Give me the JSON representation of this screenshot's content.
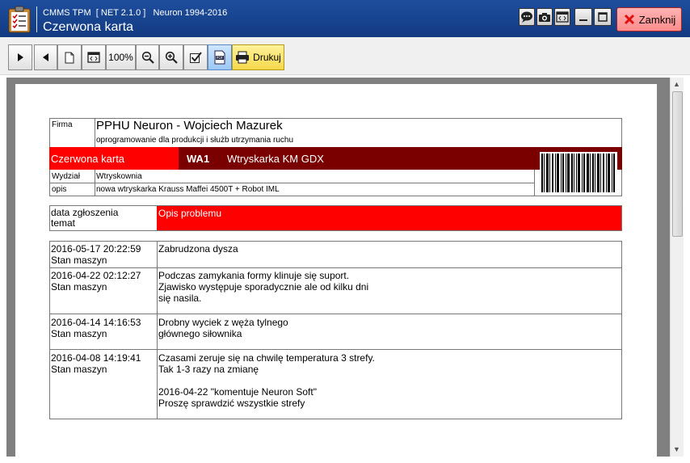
{
  "titlebar": {
    "app_line": "CMMS TPM  [ NET 2.1.0 ]   Neuron 1994-2016",
    "window_title": "Czerwona karta",
    "close_label": "Zamknij"
  },
  "toolbar": {
    "zoom_label": "100%",
    "print_label": "Drukuj"
  },
  "report": {
    "firma_label": "Firma",
    "company_name": "PPHU Neuron - Wojciech Mazurek",
    "company_sub": "oprogramowanie dla produkcji i służb utrzymania ruchu",
    "card_label": "Czerwona karta",
    "machine_code": "WA1",
    "machine_name": "Wtryskarka KM GDX",
    "wydzial_label": "Wydział",
    "wydzial_value": "Wtryskownia",
    "opis_label": "opis",
    "opis_value": "nowa wtryskarka Krauss Maffei 4500T + Robot IML",
    "col_date_line1": "data zgłoszenia",
    "col_date_line2": "temat",
    "col_problem": "Opis problemu",
    "entries": [
      {
        "date": "2016-05-17 20:22:59",
        "topic": "Stan maszyn",
        "lines": [
          "Zabrudzona dysza"
        ]
      },
      {
        "date": "2016-04-22 02:12:27",
        "topic": "Stan maszyn",
        "lines": [
          "Podczas zamykania formy klinuje się suport.",
          "Zjawisko występuje sporadycznie ale od kilku dni",
          "się nasila."
        ]
      },
      {
        "date": "2016-04-14 14:16:53",
        "topic": "Stan maszyn",
        "lines": [
          "Drobny wyciek z węża tylnego",
          "głównego siłownika"
        ]
      },
      {
        "date": "2016-04-08 14:19:41",
        "topic": "Stan maszyn",
        "lines": [
          "Czasami zeruje się na chwilę temperatura 3 strefy.",
          "Tak 1-3 razy na zmianę",
          "",
          "2016-04-22 \"komentuje  Neuron Soft\"",
          "Proszę sprawdzić wszystkie strefy"
        ]
      }
    ]
  }
}
